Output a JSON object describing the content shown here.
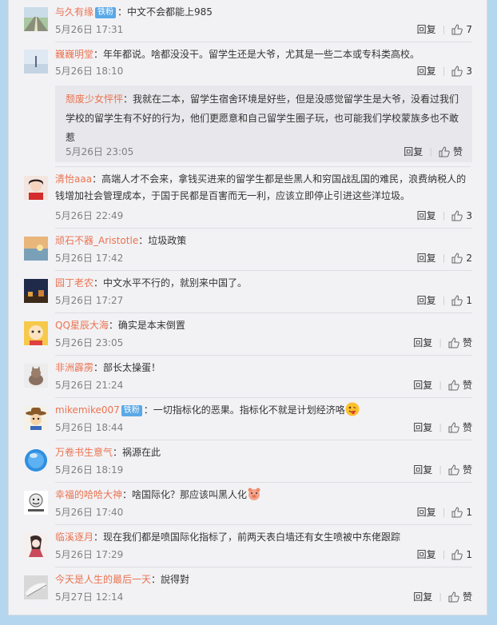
{
  "labels": {
    "reply": "回复",
    "like": "赞",
    "sep": "|"
  },
  "colors": {
    "username": "#eb7350",
    "badge": "#5aa8e6",
    "page_bg": "#b4d6ee",
    "panel_bg": "#f2f2f5"
  },
  "comments": [
    {
      "user": "与久有缘",
      "badge": "铁粉",
      "text": "：中文不会都能上985",
      "time": "5月26日 17:31",
      "likes": "7",
      "avatar": "landscape-road"
    },
    {
      "user": "巍巍明堂",
      "badge": "",
      "text": "：年年都说。啥都没没干。留学生还是大爷，尤其是一些二本或专科类高校。",
      "time": "5月26日 18:10",
      "likes": "3",
      "avatar": "sky-figure",
      "sub_reply": {
        "user": "颓废少女怦怦",
        "text": "：我就在二本，留学生宿舍环境是好些，但是没感觉留学生是大爷，没看过我们学校的留学生有不好的行为，他们更愿意和自己留学生圈子玩，也可能我们学校蒙族多也不敢惹",
        "time": "5月26日 23:05",
        "likes": "赞"
      }
    },
    {
      "user": "清怡aaa",
      "badge": "",
      "text": "：高端人才不会来，拿钱买进来的留学生都是些黑人和穷国战乱国的难民，浪费纳税人的钱增加社会管理成本，于国于民都是百害而无一利，应该立即停止引进这些洋垃圾。",
      "time": "5月26日 22:49",
      "likes": "3",
      "avatar": "girl-portrait"
    },
    {
      "user": "顽石不器_Aristotle",
      "badge": "",
      "text": "：垃圾政策",
      "time": "5月26日 17:42",
      "likes": "2",
      "avatar": "sunset-lake"
    },
    {
      "user": "园丁老农",
      "badge": "",
      "text": "：中文水平不行的，就别来中国了。",
      "time": "5月26日 17:27",
      "likes": "1",
      "avatar": "night-town"
    },
    {
      "user": "QQ星辰大海",
      "badge": "",
      "text": "：确实是本末倒置",
      "time": "5月26日 23:05",
      "likes": "赞",
      "avatar": "cartoon-kid"
    },
    {
      "user": "非洲霹雳",
      "badge": "",
      "text": "：部长太操蛋！",
      "time": "5月26日 21:24",
      "likes": "赞",
      "avatar": "kitten"
    },
    {
      "user": "mikemike007",
      "badge": "铁粉",
      "text": "：一切指标化的恶果。指标化不就是计划经济咯",
      "emoji": "tongue-emoji",
      "time": "5月26日 18:44",
      "likes": "赞",
      "avatar": "cowboy-cartoon"
    },
    {
      "user": "万卷书生意气",
      "badge": "",
      "text": "：祸源在此",
      "time": "5月26日 18:19",
      "likes": "赞",
      "avatar": "blue-sphere"
    },
    {
      "user": "幸福的哈哈大神",
      "badge": "",
      "text": "：啥国际化？那应该叫黑人化",
      "emoji": "pig-emoji",
      "time": "5月26日 17:40",
      "likes": "1",
      "avatar": "meme-face"
    },
    {
      "user": "临溪逐月",
      "badge": "",
      "text": "：现在我们都是喷国际化指标了，前两天表白墙还有女生喷被中东佬跟踪",
      "time": "5月26日 17:29",
      "likes": "1",
      "avatar": "anime-sketch"
    },
    {
      "user": "今天是人生的最后一天",
      "badge": "",
      "text": "：說得對",
      "time": "5月27日 12:14",
      "likes": "赞",
      "avatar": "gray-sketch"
    }
  ]
}
